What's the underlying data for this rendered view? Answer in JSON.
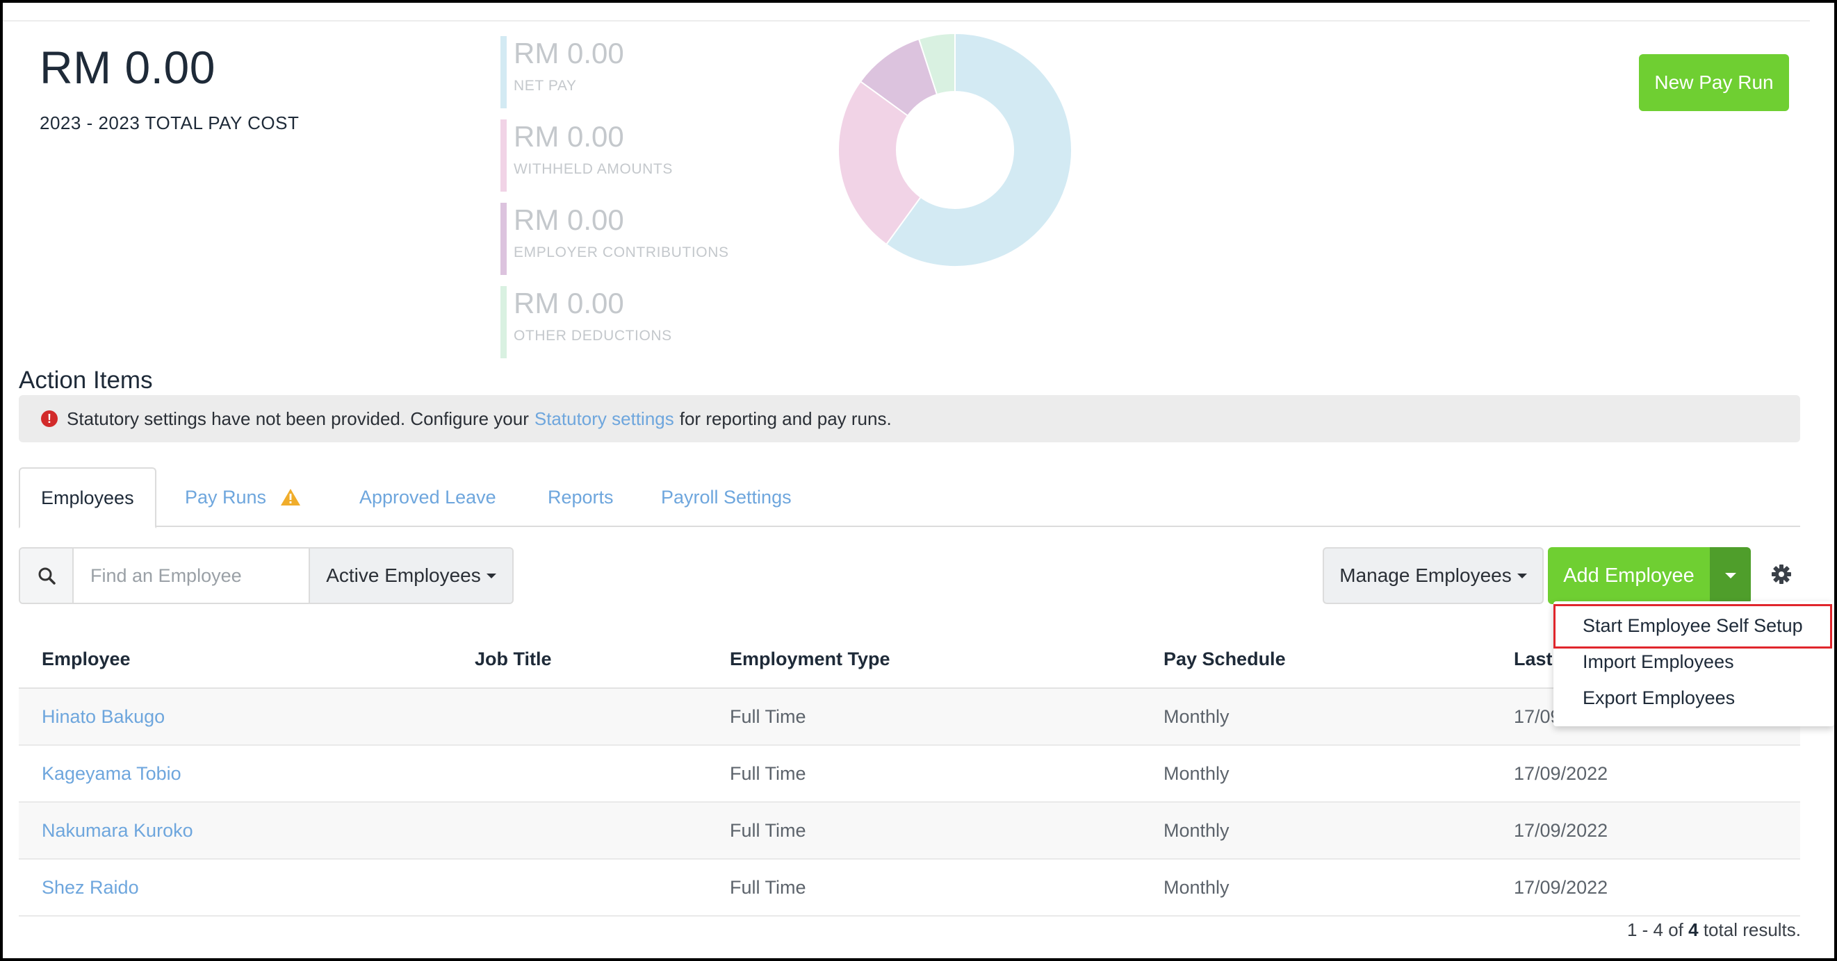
{
  "summary": {
    "total_amount": "RM 0.00",
    "total_label": "2023 - 2023 TOTAL PAY COST",
    "stats": [
      {
        "amount": "RM 0.00",
        "label": "NET PAY",
        "color": "#d3eaf3"
      },
      {
        "amount": "RM 0.00",
        "label": "WITHHELD AMOUNTS",
        "color": "#f1d3e6"
      },
      {
        "amount": "RM 0.00",
        "label": "EMPLOYER CONTRIBUTIONS",
        "color": "#dcc3de"
      },
      {
        "amount": "RM 0.00",
        "label": "OTHER DEDUCTIONS",
        "color": "#d9f1e1"
      }
    ],
    "new_pay_run_label": "New Pay Run"
  },
  "chart_data": {
    "type": "pie",
    "categories": [
      "NET PAY",
      "WITHHELD AMOUNTS",
      "EMPLOYER CONTRIBUTIONS",
      "OTHER DEDUCTIONS"
    ],
    "values": [
      60,
      25,
      10,
      5
    ],
    "colors": [
      "#d3eaf3",
      "#f1d3e6",
      "#dcc3de",
      "#d9f1e1"
    ],
    "donut": true
  },
  "action_items": {
    "title": "Action Items",
    "alert_prefix": "Statutory settings have not been provided. Configure your",
    "alert_link": "Statutory settings",
    "alert_suffix": "for reporting and pay runs."
  },
  "tabs": [
    {
      "label": "Employees",
      "active": true
    },
    {
      "label": "Pay Runs",
      "warning": true
    },
    {
      "label": "Approved Leave"
    },
    {
      "label": "Reports"
    },
    {
      "label": "Payroll Settings"
    }
  ],
  "toolbar": {
    "search_placeholder": "Find an Employee",
    "filter_label": "Active Employees",
    "manage_label": "Manage Employees",
    "add_label": "Add Employee"
  },
  "menu": {
    "items": [
      "Start Employee Self Setup",
      "Import Employees",
      "Export Employees"
    ]
  },
  "table": {
    "headers": [
      "Employee",
      "Job Title",
      "Employment Type",
      "Pay Schedule",
      "Last"
    ],
    "rows": [
      {
        "name": "Hinato Bakugo",
        "job": "",
        "type": "Full Time",
        "schedule": "Monthly",
        "last": "17/09"
      },
      {
        "name": "Kageyama Tobio",
        "job": "",
        "type": "Full Time",
        "schedule": "Monthly",
        "last": "17/09/2022"
      },
      {
        "name": "Nakumara Kuroko",
        "job": "",
        "type": "Full Time",
        "schedule": "Monthly",
        "last": "17/09/2022"
      },
      {
        "name": "Shez Raido",
        "job": "",
        "type": "Full Time",
        "schedule": "Monthly",
        "last": "17/09/2022"
      }
    ],
    "results_range": "1 - 4 of",
    "results_total": "4",
    "results_suffix": "total results."
  }
}
